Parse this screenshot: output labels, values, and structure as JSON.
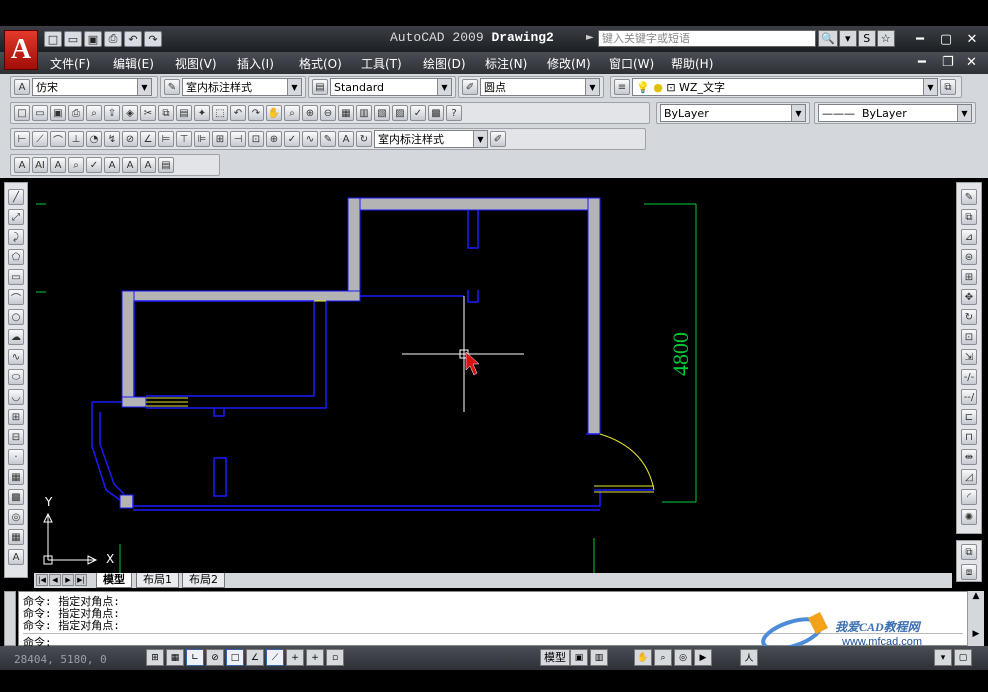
{
  "title": {
    "app": "AutoCAD 2009",
    "drawing": "Drawing2"
  },
  "search": {
    "placeholder": "键入关键字或短语"
  },
  "menu": [
    {
      "label": "文件(F)"
    },
    {
      "label": "编辑(E)"
    },
    {
      "label": "视图(V)"
    },
    {
      "label": "插入(I)"
    },
    {
      "label": "格式(O)"
    },
    {
      "label": "工具(T)"
    },
    {
      "label": "绘图(D)"
    },
    {
      "label": "标注(N)"
    },
    {
      "label": "修改(M)"
    },
    {
      "label": "窗口(W)"
    },
    {
      "label": "帮助(H)"
    }
  ],
  "toolbar": {
    "text_font": "仿宋",
    "dim_style": "室内标注样式",
    "text_style": "Standard",
    "point_style": "圆点",
    "layer": "WZ_文字",
    "color": "ByLayer",
    "linetype": "ByLayer",
    "dim_style_2": "室内标注样式"
  },
  "drawing": {
    "dimension_label": "4800",
    "ucs_x": "X",
    "ucs_y": "Y"
  },
  "tabs": [
    {
      "label": "模型"
    },
    {
      "label": "布局1"
    },
    {
      "label": "布局2"
    }
  ],
  "command": {
    "lines": [
      "命令: 指定对角点:",
      "命令: 指定对角点:",
      "命令: 指定对角点:",
      "命令:"
    ]
  },
  "watermark": {
    "name": "我爱CAD教程网",
    "url": "www.mfcad.com"
  },
  "status": {
    "coords": "28404, 5180, 0",
    "model_label": "模型"
  },
  "colors": {
    "wall_fill": "#b4b4b4",
    "wall_outline": "#1a1aff",
    "dimension": "#00cc33",
    "door": "#e6e62e",
    "canvas": "#000000"
  }
}
